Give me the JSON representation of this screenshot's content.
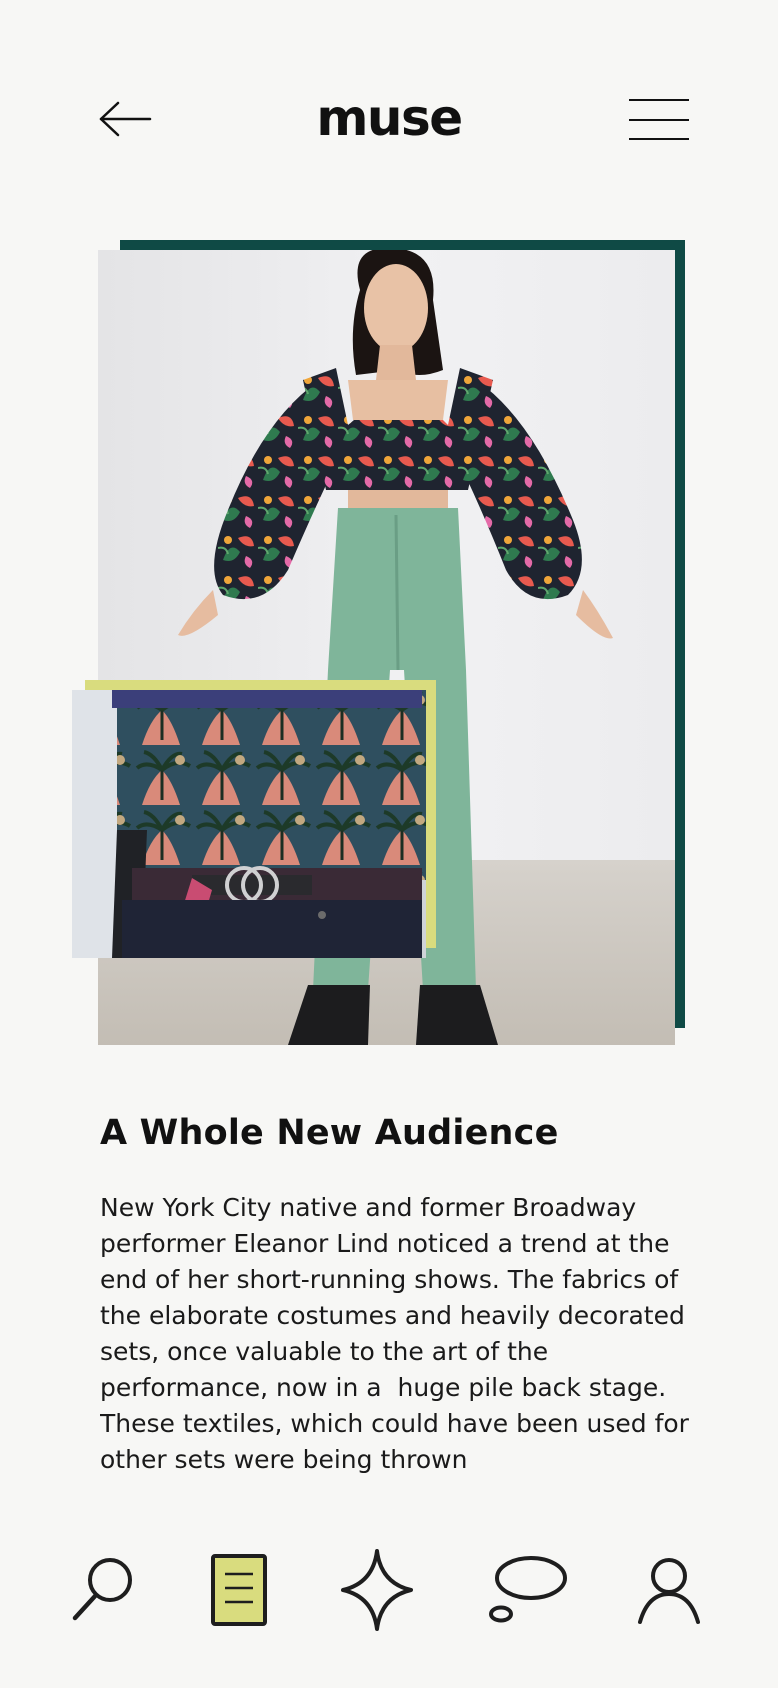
{
  "header": {
    "brand": "muse",
    "back_icon": "arrow-left-icon",
    "menu_icon": "hamburger-menu-icon"
  },
  "colors": {
    "background": "#f7f7f5",
    "frame_dark": "#0f4a45",
    "frame_light": "#d9dc7e",
    "active_nav": "#d9dc7e"
  },
  "article": {
    "title": "A Whole New Audience",
    "body": "New York City native and former Broadway performer Eleanor Lind noticed a trend at the end of her short-running shows. The fabrics of the elaborate costumes and heavily decorated sets, once valuable to the art of the performance, now in a  huge pile back stage. These textiles, which could have been used for other sets were being thrown"
  },
  "nav": {
    "items": [
      {
        "icon": "search-icon",
        "active": false
      },
      {
        "icon": "article-icon",
        "active": true
      },
      {
        "icon": "sparkle-icon",
        "active": false
      },
      {
        "icon": "chat-bubble-icon",
        "active": false
      },
      {
        "icon": "profile-icon",
        "active": false
      }
    ]
  }
}
